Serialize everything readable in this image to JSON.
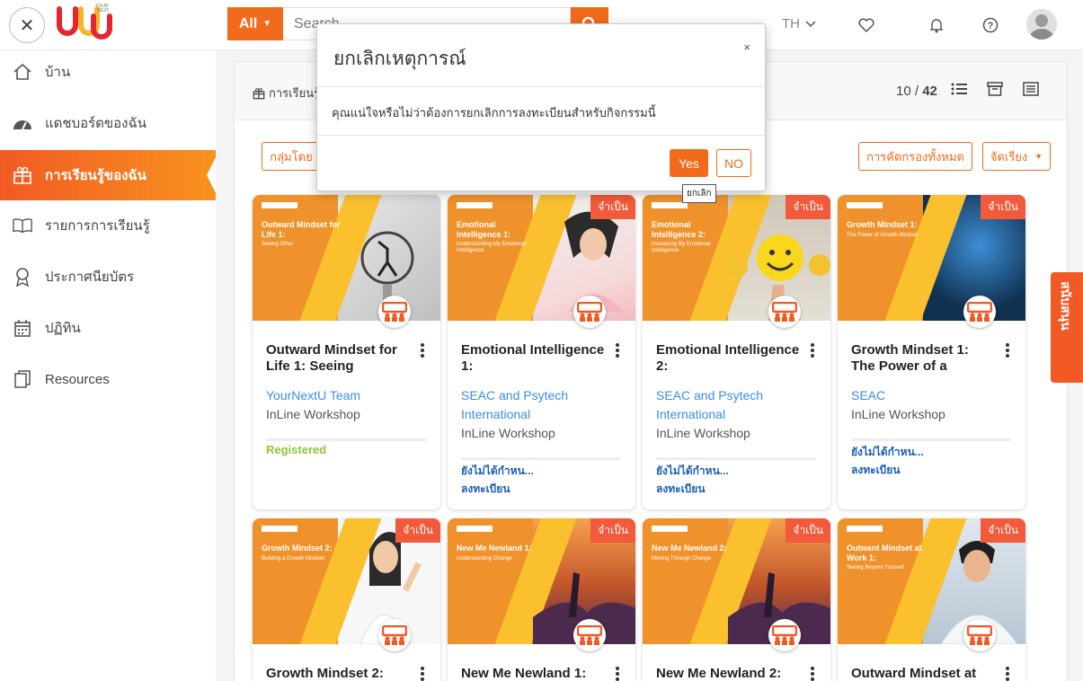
{
  "topbar": {
    "all_label": "All",
    "search_placeholder": "Search",
    "lang": "TH"
  },
  "sidebar": {
    "items": [
      {
        "label": "บ้าน",
        "icon": "home-icon"
      },
      {
        "label": "แดชบอร์ดของฉัน",
        "icon": "dashboard-icon"
      },
      {
        "label": "การเรียนรู้ของฉัน",
        "icon": "gift-icon"
      },
      {
        "label": "รายการการเรียนรู้",
        "icon": "book-icon"
      },
      {
        "label": "ประกาศนียบัตร",
        "icon": "certificate-icon"
      },
      {
        "label": "ปฏิทิน",
        "icon": "calendar-icon"
      },
      {
        "label": "Resources",
        "icon": "documents-icon"
      }
    ]
  },
  "panel": {
    "breadcrumb": "การเรียนรู้",
    "count_current": "10",
    "count_sep": " / ",
    "count_total": "42",
    "group_by": "กลุ่มโดย",
    "all_filters": "การคัดกรองทั้งหมด",
    "sort": "จัดเรียง"
  },
  "cards": [
    {
      "img_title": "Outward Mindset for Life 1:",
      "img_sub": "Seeing Other",
      "title": "Outward Mindset for Life 1: Seeing",
      "org": "YourNextU Team",
      "type": "InLine Workshop",
      "status": "Registered",
      "required": ""
    },
    {
      "img_title": "Emotional Intelligence 1:",
      "img_sub": "Understanding My Emotional Intelligence",
      "title": "Emotional Intelligence 1:",
      "org": "SEAC and Psytech International",
      "type": "InLine Workshop",
      "status": "ยังไม่ได้กำหน...",
      "action": "ลงทะเบียน",
      "required": "จำเป็น"
    },
    {
      "img_title": "Emotional Intelligence 2:",
      "img_sub": "Increasing My Emotional Intelligence",
      "title": "Emotional Intelligence 2:",
      "org": "SEAC and Psytech International",
      "type": "InLine Workshop",
      "status": "ยังไม่ได้กำหน...",
      "action": "ลงทะเบียน",
      "required": "จำเป็น"
    },
    {
      "img_title": "Growth Mindset 1:",
      "img_sub": "The Power of Growth Mindset",
      "title": "Growth Mindset 1: The Power of a",
      "org": "SEAC",
      "type": "InLine Workshop",
      "status": "ยังไม่ได้กำหน...",
      "action": "ลงทะเบียน",
      "required": "จำเป็น"
    },
    {
      "img_title": "Growth Mindset 2:",
      "img_sub": "Building a Growth Mindset",
      "title": "Growth Mindset 2:",
      "required": "จำเป็น"
    },
    {
      "img_title": "New Me Newland 1:",
      "img_sub": "Understanding Change",
      "title": "New Me Newland 1:",
      "required": "จำเป็น"
    },
    {
      "img_title": "New Me Newland 2:",
      "img_sub": "Moving Through Change",
      "title": "New Me Newland 2:",
      "required": "จำเป็น"
    },
    {
      "img_title": "Outward Mindset at Work 1:",
      "img_sub": "Seeing Beyond Yourself",
      "title": "Outward Mindset at",
      "required": "จำเป็น"
    }
  ],
  "modal": {
    "title": "ยกเลิกเหตุการณ์",
    "close": "×",
    "body": "คุณแน่ใจหรือไม่ว่าต้องการยกเลิกการลงทะเบียนสำหรับกิจกรรมนี้",
    "yes": "Yes",
    "no": "NO",
    "tooltip": "ยกเลิก"
  },
  "sidetab": "สนับสนุน",
  "colors": {
    "accent": "#f26a1b",
    "link": "#3a8ee6",
    "registered": "#8cc63f"
  }
}
